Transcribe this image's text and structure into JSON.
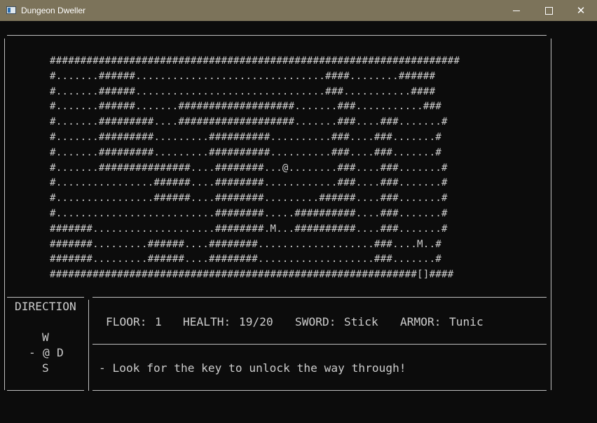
{
  "window": {
    "title": "Dungeon Dweller",
    "controls": {
      "minimize": "—",
      "maximize": "☐",
      "close": "✕"
    }
  },
  "map": {
    "rows": [
      "###################################################################",
      "#.......######...............................####........######",
      "#.......######...............................###...........####",
      "#.......######.......###################.......###...........###",
      "#.......#########....###################.......###....###.......#",
      "#.......#########.........##########..........###....###.......#",
      "#.......#########.........##########..........###....###.......#",
      "#.......###############....########...@........###....###.......#",
      "#................######....########............###....###.......#",
      "#................######....########.........######....###.......#",
      "#..........................########.....##########....###.......#",
      "#######....................########.M...##########....###.......#",
      "#######.........######....########...................###....M..#",
      "#######.........######....########...................###.......#",
      "############################################################[]####"
    ]
  },
  "direction_panel": {
    "title": "DIRECTION",
    "up": "W",
    "left": "-",
    "player": "@",
    "right": "D",
    "down": "S"
  },
  "status": {
    "floor_label": "FLOOR:",
    "floor_value": "1",
    "health_label": "HEALTH:",
    "health_value": "19/20",
    "sword_label": "SWORD:",
    "sword_value": "Stick",
    "armor_label": "ARMOR:",
    "armor_value": "Tunic"
  },
  "message": "- Look for the key to unlock the way through!",
  "colors": {
    "titlebar": "#7c735a",
    "console_bg": "#0c0c0c",
    "console_text": "#cccccc"
  }
}
